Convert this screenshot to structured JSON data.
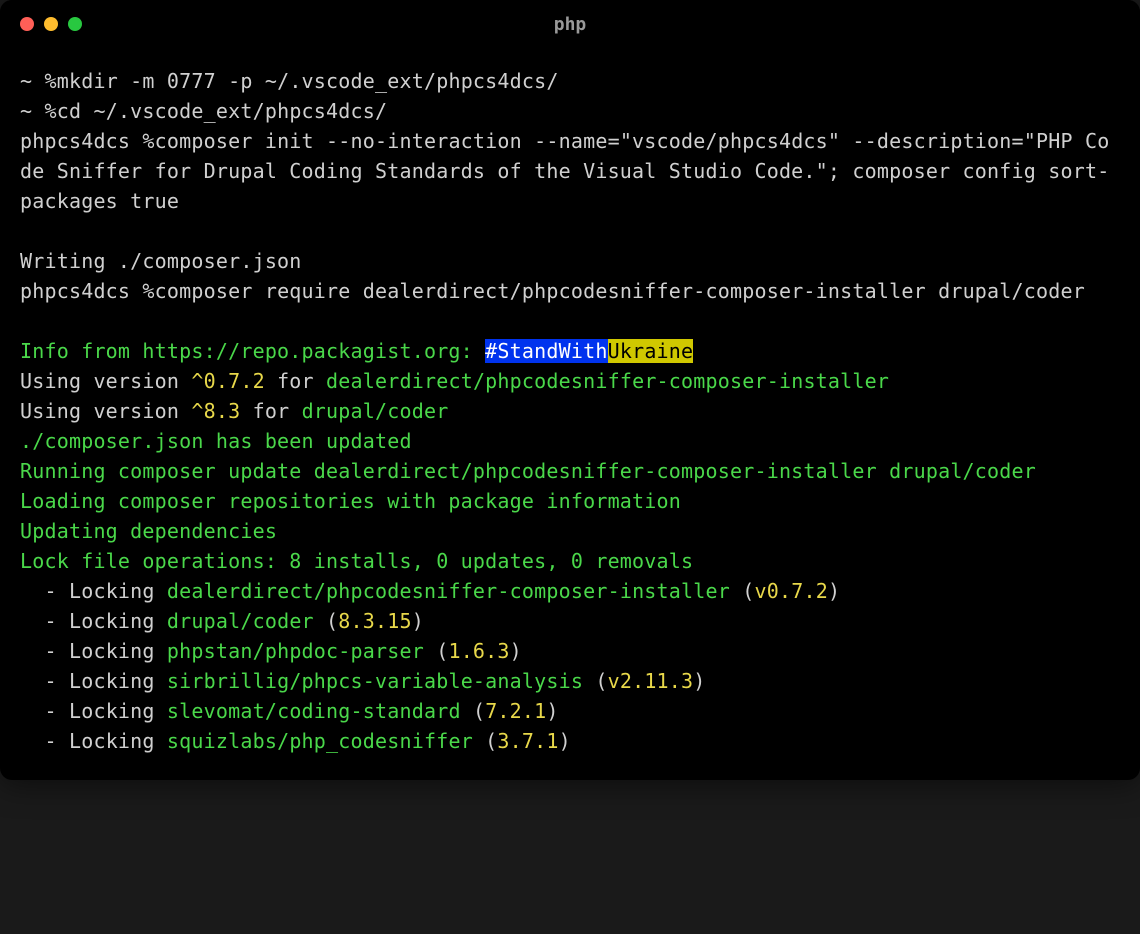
{
  "window": {
    "title": "php"
  },
  "prompts": {
    "home": "~ %",
    "phpcs4dcs": "phpcs4dcs %"
  },
  "commands": {
    "mkdir": "mkdir -m 0777 -p ~/.vscode_ext/phpcs4dcs/",
    "cd": "cd ~/.vscode_ext/phpcs4dcs/",
    "composer_init": "composer init --no-interaction --name=\"vscode/phpcs4dcs\" --description=\"PHP Code Sniffer for Drupal Coding Standards of the Visual Studio Code.\"; composer config sort-packages true",
    "composer_require": "composer require dealerdirect/phpcodesniffer-composer-installer drupal/coder"
  },
  "output": {
    "writing_json": "Writing ./composer.json",
    "info_prefix": "Info from https://repo.packagist.org: ",
    "banner_blue": "#StandWith",
    "banner_yellow": "Ukraine",
    "using_version_1a": "Using version ",
    "using_version_1b": "^0.7.2",
    "using_version_1c": " for ",
    "using_version_1d": "dealerdirect/phpcodesniffer-composer-installer",
    "using_version_2a": "Using version ",
    "using_version_2b": "^8.3",
    "using_version_2c": " for ",
    "using_version_2d": "drupal/coder",
    "json_updated": "./composer.json has been updated",
    "running_update": "Running composer update dealerdirect/phpcodesniffer-composer-installer drupal/coder",
    "loading_repos": "Loading composer repositories with package information",
    "updating_deps": "Updating dependencies",
    "lock_ops": "Lock file operations: 8 installs, 0 updates, 0 removals",
    "locks": [
      {
        "pkg": "dealerdirect/phpcodesniffer-composer-installer",
        "ver": "v0.7.2"
      },
      {
        "pkg": "drupal/coder",
        "ver": "8.3.15"
      },
      {
        "pkg": "phpstan/phpdoc-parser",
        "ver": "1.6.3"
      },
      {
        "pkg": "sirbrillig/phpcs-variable-analysis",
        "ver": "v2.11.3"
      },
      {
        "pkg": "slevomat/coding-standard",
        "ver": "7.2.1"
      },
      {
        "pkg": "squizlabs/php_codesniffer",
        "ver": "3.7.1"
      }
    ],
    "lock_prefix": "  - Locking ",
    "paren_open": " (",
    "paren_close": ")"
  }
}
